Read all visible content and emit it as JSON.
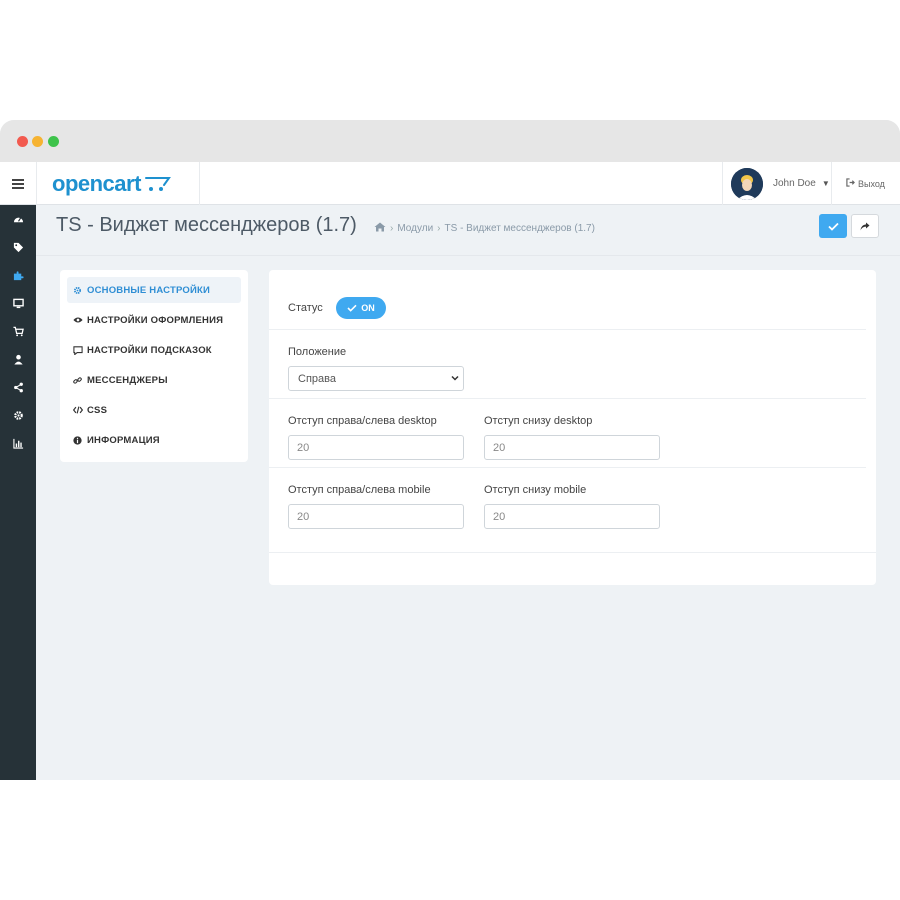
{
  "header": {
    "logo_text": "opencart",
    "user_name": "John Doe",
    "logout_label": "Выход"
  },
  "page": {
    "title": "TS - Виджет мессенджеров (1.7)",
    "breadcrumb": [
      "Модули",
      "TS - Виджет мессенджеров (1.7)"
    ]
  },
  "sidebar_icons": [
    "dashboard-icon",
    "tag-icon",
    "puzzle-icon",
    "monitor-icon",
    "cart-icon",
    "user-icon",
    "share-icon",
    "gear-icon",
    "bar-chart-icon"
  ],
  "nav": {
    "items": [
      {
        "label": "ОСНОВНЫЕ НАСТРОЙКИ",
        "icon": "gear-icon",
        "active": true
      },
      {
        "label": "НАСТРОЙКИ ОФОРМЛЕНИЯ",
        "icon": "eye-icon",
        "active": false
      },
      {
        "label": "НАСТРОЙКИ ПОДСКАЗОК",
        "icon": "comment-icon",
        "active": false
      },
      {
        "label": "МЕССЕНДЖЕРЫ",
        "icon": "link-icon",
        "active": false
      },
      {
        "label": "CSS",
        "icon": "code-icon",
        "active": false
      },
      {
        "label": "ИНФОРМАЦИЯ",
        "icon": "info-icon",
        "active": false
      }
    ]
  },
  "form": {
    "status_label": "Статус",
    "status_toggle": "ON",
    "position_label": "Положение",
    "position_value": "Справа",
    "offset_side_desktop_label": "Отступ справа/слева desktop",
    "offset_side_desktop_value": "20",
    "offset_bottom_desktop_label": "Отступ снизу desktop",
    "offset_bottom_desktop_value": "20",
    "offset_side_mobile_label": "Отступ справа/слева mobile",
    "offset_side_mobile_value": "20",
    "offset_bottom_mobile_label": "Отступ снизу mobile",
    "offset_bottom_mobile_value": "20"
  },
  "colors": {
    "accent": "#3fa9f0",
    "sidebar": "#263238",
    "logo": "#1e91cf",
    "background": "#eef2f5"
  }
}
